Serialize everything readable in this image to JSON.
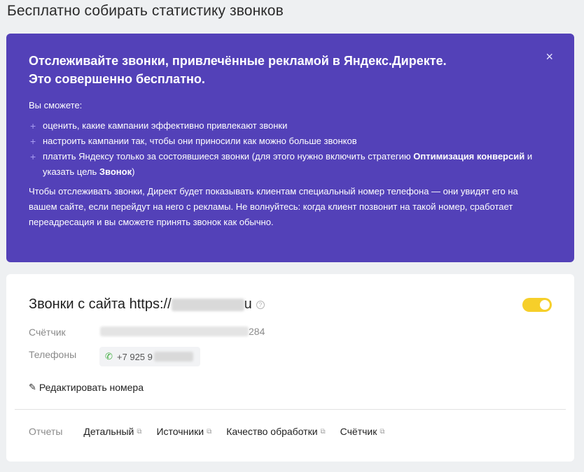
{
  "page": {
    "title": "Бесплатно собирать статистику звонков"
  },
  "promo": {
    "heading_line1": "Отслеживайте звонки, привлечённые рекламой в Яндекс.Директе.",
    "heading_line2": "Это совершенно бесплатно.",
    "close_icon": "×",
    "lead": "Вы сможете:",
    "benefits": [
      {
        "text": "оценить, какие кампании эффективно привлекают звонки"
      },
      {
        "text": "настроить кампании так, чтобы они приносили как можно больше звонков"
      },
      {
        "text_before": "платить Яндексу только за состоявшиеся звонки (для этого нужно включить стратегию ",
        "strategy": "Оптимизация конверсий",
        "text_middle": " и указать цель ",
        "goal": "Звонок",
        "text_after": ")"
      }
    ],
    "note": "Чтобы отслеживать звонки, Директ будет показывать клиентам специальный номер телефона — они увидят его на вашем сайте, если перейдут на него с рекламы. Не волнуйтесь: когда клиент позвонит на такой номер, сработает переадресация и вы сможете принять звонок как обычно."
  },
  "card": {
    "title": "Звонки с сайта https://",
    "title_suffix": "u",
    "help_icon": "?",
    "toggle_on": true,
    "counter_label": "Счётчик",
    "counter_suffix": "284",
    "phones_label": "Телефоны",
    "phone_icon": "phone-forward-icon",
    "phone_visible": "+7 925 9",
    "edit_label": "Редактировать номера",
    "reports_label": "Отчеты",
    "report_links": [
      {
        "label": "Детальный"
      },
      {
        "label": "Источники"
      },
      {
        "label": "Качество обработки"
      },
      {
        "label": "Счётчик"
      }
    ]
  },
  "colors": {
    "promo_bg": "#5341b8",
    "toggle_on": "#f6cf2a",
    "phone_icon": "#3fae3f"
  }
}
